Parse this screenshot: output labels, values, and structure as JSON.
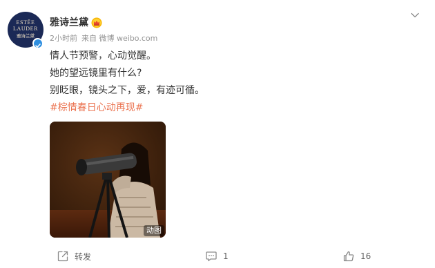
{
  "account": {
    "name": "雅诗兰黛",
    "avatar_text": {
      "line1": "ESTĒE",
      "line2": "LAUDER",
      "line3": "雅诗兰黛"
    }
  },
  "meta": {
    "time": "2小时前",
    "source": "来自 微博 weibo.com"
  },
  "post": {
    "lines": [
      "情人节预警，心动觉醒。",
      "她的望远镜里有什么?",
      "别眨眼，镜头之下，爱，有迹可循。"
    ],
    "hashtag": "#棕情春日心动再现#"
  },
  "media": {
    "badge": "动图"
  },
  "actions": {
    "repost_label": "转发",
    "comment_count": "1",
    "like_count": "16"
  },
  "colors": {
    "hashtag": "#eb7350",
    "verified": "#2f8fe0",
    "avatar_bg": "#1b2956",
    "vip_badge": "#f7b500"
  },
  "icons": {
    "verified": "verified-check-icon",
    "vip": "vip-crown-icon",
    "more": "chevron-down-icon",
    "repost": "repost-icon",
    "comment": "comment-icon",
    "like": "thumbs-up-icon"
  }
}
